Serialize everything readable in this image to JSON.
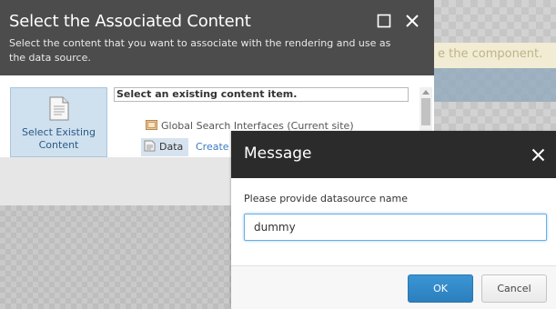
{
  "background": {
    "strip_text": "e the component."
  },
  "associated_dialog": {
    "title": "Select the Associated Content",
    "subtitle": "Select the content that you want to associate with the rendering and use as the data source.",
    "maximize_icon": "maximize-icon",
    "close_icon": "close-icon",
    "tile": {
      "icon": "document-icon",
      "label": "Select Existing Content"
    },
    "panel_heading": "Select an existing content item.",
    "tree": [
      {
        "icon": "folder-icon",
        "label": "Global Search Interfaces (Current site)"
      },
      {
        "icon": "data-folder-icon",
        "label": "Data"
      }
    ],
    "create_link": "Create"
  },
  "message_dialog": {
    "title": "Message",
    "close_icon": "close-icon",
    "prompt_label": "Please provide datasource name",
    "input_value": "dummy",
    "ok_label": "OK",
    "cancel_label": "Cancel"
  }
}
